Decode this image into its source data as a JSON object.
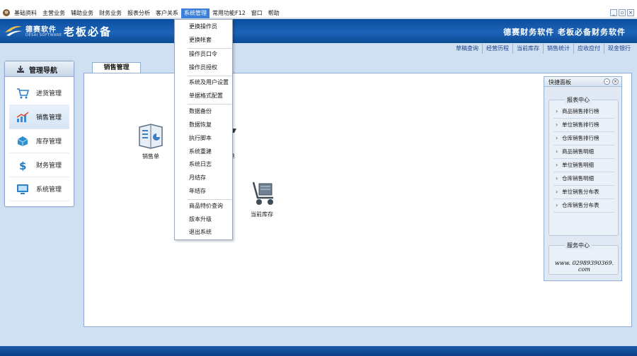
{
  "menubar": {
    "items": [
      "基础资料",
      "主营业务",
      "辅助业务",
      "财务业务",
      "报表分析",
      "客户关系",
      "系统管理",
      "常用功能F12",
      "窗口",
      "帮助"
    ],
    "active_index": 6,
    "win_buttons": [
      "_",
      "▫",
      "×"
    ]
  },
  "banner": {
    "brand_cn": "德赛软件",
    "brand_en": "DESAI SOFTWARE",
    "app_title": "老板必备",
    "slogan": "德赛财务软件 老板必备财务软件",
    "colors": {
      "dark": "#0b4e9e",
      "light": "#1c63b6"
    }
  },
  "quicklinks": [
    "草稿查询",
    "经营历程",
    "当前库存",
    "销售统计",
    "应收应付",
    "现金银行"
  ],
  "sidebar": {
    "title": "管理导航",
    "items": [
      {
        "label": "进货管理",
        "icon": "cart-icon"
      },
      {
        "label": "销售管理",
        "icon": "chart-up-icon"
      },
      {
        "label": "库存管理",
        "icon": "box-icon"
      },
      {
        "label": "财务管理",
        "icon": "dollar-icon"
      },
      {
        "label": "系统管理",
        "icon": "monitor-icon"
      }
    ],
    "active_index": 1
  },
  "main": {
    "tab_label": "销售管理",
    "functions": [
      {
        "label": "销售单",
        "icon": "sales-order-icon"
      },
      {
        "label": "单",
        "icon": "return-order-icon"
      },
      {
        "label": "当前库存",
        "icon": "inventory-cart-icon"
      }
    ]
  },
  "quickpanel": {
    "title": "快捷面板",
    "reports_title": "报表中心",
    "reports": [
      "商品销售排行榜",
      "单位销售排行榜",
      "仓库销售排行榜",
      "商品销售明细",
      "单位销售明细",
      "仓库销售明细",
      "单位销售分布表",
      "仓库销售分布表"
    ],
    "service_title": "服务中心",
    "contact": "www. 02989390369. com"
  },
  "dropdown": {
    "groups": [
      [
        "更换操作员",
        "更换帐套"
      ],
      [
        "操作员口令",
        "操作员授权"
      ],
      [
        "系统及用户设置",
        "单据格式配置"
      ],
      [
        "数据备份",
        "数据恢复",
        "执行脚本",
        "系统重建",
        "系统日志",
        "月结存",
        "年结存"
      ],
      [
        "商品特价查询",
        "版本升级",
        "退出系统"
      ]
    ]
  }
}
